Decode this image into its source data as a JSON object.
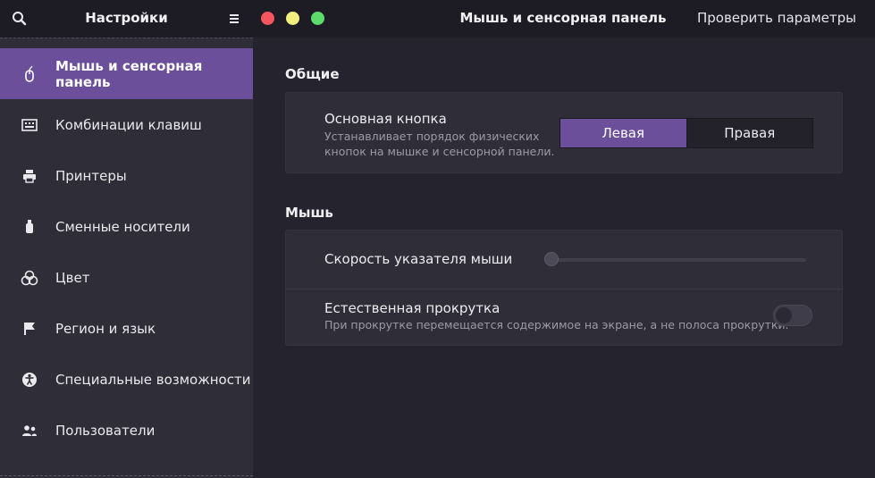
{
  "header": {
    "sidebar_title": "Настройки",
    "page_title": "Мышь и сенсорная панель",
    "check_label": "Проверить параметры",
    "window_controls": {
      "close_color": "#f4555e",
      "minimize_color": "#f3ef7e",
      "maximize_color": "#5ddc6b"
    }
  },
  "sidebar": {
    "active_index": 0,
    "accent_color": "#6b4f9a",
    "items": [
      {
        "label": "Мышь и сенсорная панель",
        "icon": "mouse-icon"
      },
      {
        "label": "Комбинации клавиш",
        "icon": "keyboard-icon"
      },
      {
        "label": "Принтеры",
        "icon": "printer-icon"
      },
      {
        "label": "Сменные носители",
        "icon": "usb-drive-icon"
      },
      {
        "label": "Цвет",
        "icon": "color-icon"
      },
      {
        "label": "Регион и язык",
        "icon": "flag-icon"
      },
      {
        "label": "Специальные возможности",
        "icon": "accessibility-icon"
      },
      {
        "label": "Пользователи",
        "icon": "users-icon"
      }
    ]
  },
  "general": {
    "section_title": "Общие",
    "primary_button": {
      "title": "Основная кнопка",
      "description_line1": "Устанавливает порядок физических",
      "description_line2": "кнопок на мышке и сенсорной панели.",
      "left_label": "Левая",
      "right_label": "Правая",
      "selected": "left"
    }
  },
  "mouse": {
    "section_title": "Мышь",
    "speed": {
      "title": "Скорость указателя мыши",
      "value_fraction": 0.0
    },
    "natural_scroll": {
      "title": "Естественная прокрутка",
      "description": "При прокрутке перемещается содержимое на экране, а не полоса прокрутки.",
      "enabled": false
    }
  }
}
